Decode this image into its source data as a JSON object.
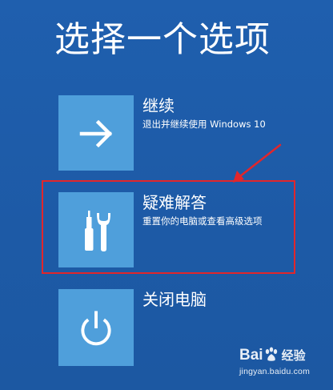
{
  "page": {
    "title": "选择一个选项"
  },
  "options": [
    {
      "title": "继续",
      "description": "退出并继续使用 Windows 10",
      "icon": "arrow-right-icon"
    },
    {
      "title": "疑难解答",
      "description": "重置你的电脑或查看高级选项",
      "icon": "tools-icon"
    },
    {
      "title": "关闭电脑",
      "description": "",
      "icon": "power-icon"
    }
  ],
  "annotation": {
    "highlight_color": "#e2262b",
    "highlighted_option": "疑难解答"
  },
  "watermark": {
    "brand_left": "Bai",
    "brand_right": "经验",
    "url": "jingyan.baidu.com"
  },
  "colors": {
    "background": "#1e5ba8",
    "tile": "#4f9fdb",
    "text": "#ffffff"
  }
}
